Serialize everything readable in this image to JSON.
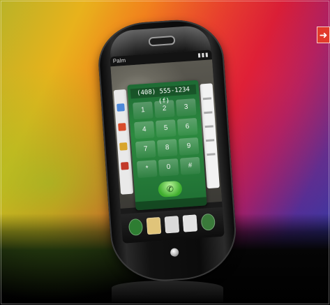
{
  "badge": {
    "icon": "arrow-right-icon",
    "color": "#e23a2b"
  },
  "phone": {
    "status_bar": {
      "carrier": "Palm"
    },
    "dialer": {
      "number": "(408) 555-1234 (f)",
      "keys": [
        "1",
        "2",
        "3",
        "4",
        "5",
        "6",
        "7",
        "8",
        "9",
        "*",
        "0",
        "#"
      ],
      "call_icon": "phone-icon"
    },
    "dock_icons": [
      "phone-icon",
      "contacts-icon",
      "email-icon",
      "calendar-icon",
      "launcher-icon"
    ]
  },
  "colors": {
    "accent": "#2c8a3f",
    "background_warm": "#f08a1a",
    "background_cool": "#2f3ea8"
  }
}
